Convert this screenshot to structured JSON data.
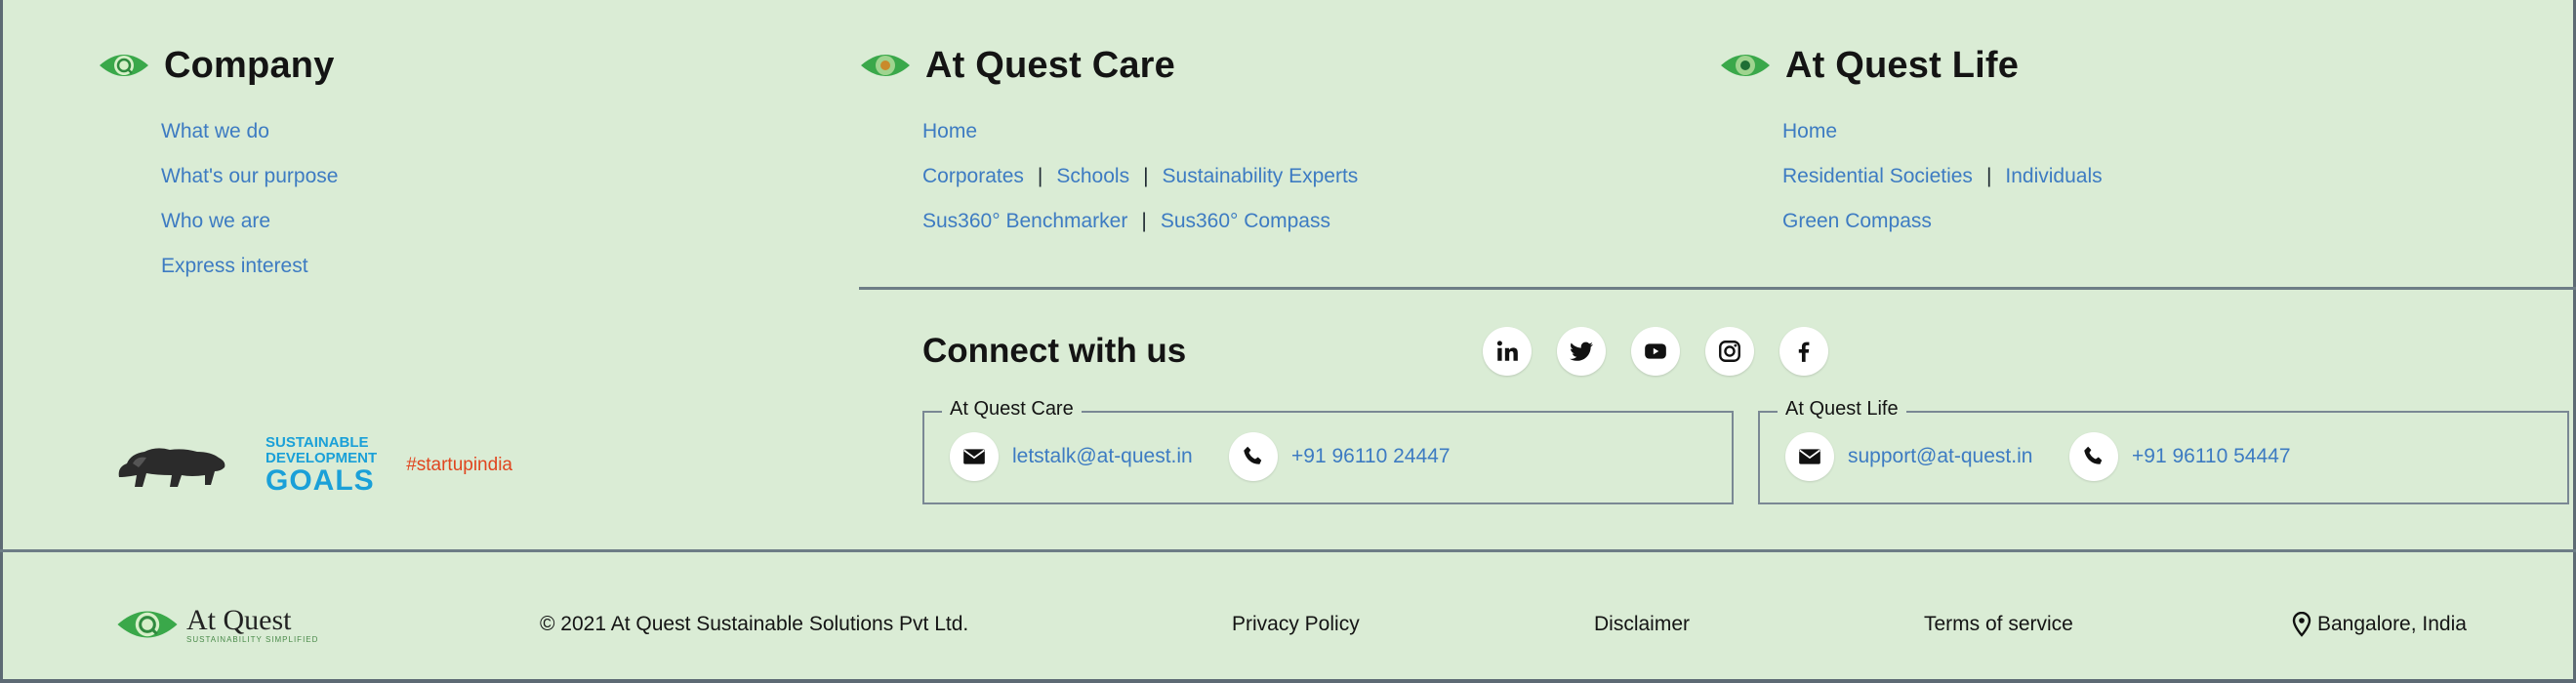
{
  "columns": {
    "company": {
      "title": "Company",
      "links": [
        "What we do",
        "What's our purpose",
        "Who we are",
        "Express interest"
      ]
    },
    "care": {
      "title": "At Quest Care",
      "home": "Home",
      "row2": [
        "Corporates",
        "Schools",
        "Sustainability Experts"
      ],
      "row3": [
        "Sus360° Benchmarker",
        "Sus360° Compass"
      ]
    },
    "life": {
      "title": "At Quest Life",
      "home": "Home",
      "row2": [
        "Residential Societies",
        "Individuals"
      ],
      "row3": [
        "Green Compass"
      ]
    },
    "separator": "|"
  },
  "connect": {
    "title": "Connect with us",
    "socials": [
      "linkedin-icon",
      "twitter-icon",
      "youtube-icon",
      "instagram-icon",
      "facebook-icon"
    ],
    "care": {
      "label": "At Quest Care",
      "email": "letstalk@at-quest.in",
      "phone": "+91 96110 24447"
    },
    "life": {
      "label": "At Quest Life",
      "email": "support@at-quest.in",
      "phone": "+91 96110 54447"
    }
  },
  "badges": {
    "sdg_line1": "SUSTAINABLE",
    "sdg_line2": "DEVELOPMENT",
    "sdg_line3": "GOALS",
    "startup": "#startupindia"
  },
  "footer": {
    "brand": "At Quest",
    "tagline": "SUSTAINABILITY SIMPLIFIED",
    "copyright": "© 2021 At Quest Sustainable Solutions Pvt Ltd.",
    "privacy": "Privacy Policy",
    "disclaimer": "Disclaimer",
    "terms": "Terms of service",
    "location": "Bangalore, India"
  },
  "colors": {
    "background": "#daecd5",
    "link": "#3d7bc2",
    "eye_green": "#3aa84a"
  }
}
